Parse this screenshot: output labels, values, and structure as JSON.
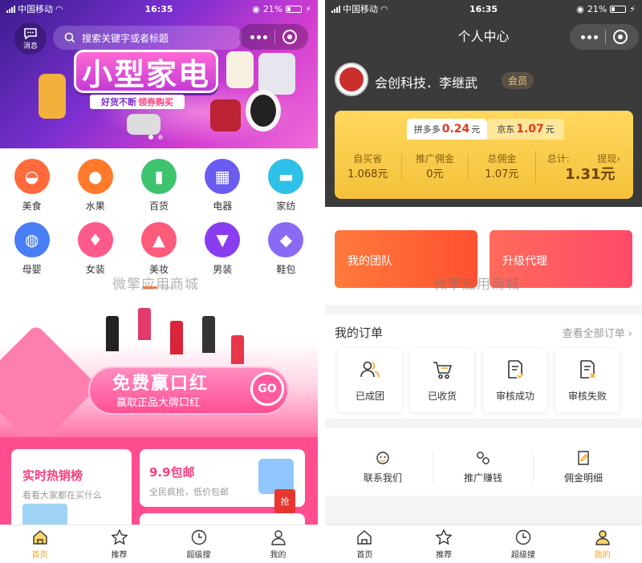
{
  "status_left": {
    "carrier": "中国移动",
    "time": "16:35",
    "battery": "21%"
  },
  "status_right": {
    "carrier": "中国移动",
    "time": "16:35",
    "battery": "21%"
  },
  "left": {
    "msg_label": "消息",
    "search_placeholder": "搜索关键字或者标题",
    "banner_title": "小型家电",
    "banner_sub1": "好货不断",
    "banner_sub2": "领券购买",
    "categories": [
      {
        "label": "美食",
        "color": "#ff6a3c"
      },
      {
        "label": "水果",
        "color": "#ff7a2a"
      },
      {
        "label": "百货",
        "color": "#3ec46d"
      },
      {
        "label": "电器",
        "color": "#6a5cf0"
      },
      {
        "label": "家纺",
        "color": "#2ec0e6"
      },
      {
        "label": "母婴",
        "color": "#4a7ef5"
      },
      {
        "label": "女装",
        "color": "#ff5b8a"
      },
      {
        "label": "美妆",
        "color": "#ff5b7a"
      },
      {
        "label": "男装",
        "color": "#8a3cf0"
      },
      {
        "label": "鞋包",
        "color": "#8a6af5"
      }
    ],
    "watermark": "微擎应用商城",
    "promo_title": "免费赢口红",
    "promo_sub": "赢取正品大牌口红",
    "promo_go": "GO",
    "card1": {
      "title": "实时热销榜",
      "sub": "看看大家都在买什么"
    },
    "card2": {
      "title": "9.9包邮",
      "sub": "全民疯抢，低价包邮",
      "tag": "抢"
    },
    "tabs": [
      "首页",
      "推荐",
      "超级搜",
      "我的"
    ]
  },
  "right": {
    "title": "个人中心",
    "user_name": "会创科技．李继武",
    "member_badge": "会员",
    "platform_tabs": [
      {
        "name": "拼多多",
        "value": "0.24",
        "unit": "元"
      },
      {
        "name": "京东",
        "value": "1.07",
        "unit": "元"
      }
    ],
    "stats": [
      {
        "label": "自买省",
        "value": "1.068元"
      },
      {
        "label": "推广佣金",
        "value": "0元"
      },
      {
        "label": "总佣金",
        "value": "1.07元"
      }
    ],
    "total_label": "总计:",
    "withdraw_label": "提现›",
    "total_value": "1.31元",
    "team_label": "我的团队",
    "upgrade_label": "升级代理",
    "watermark": "微擎应用商城",
    "orders_title": "我的订单",
    "all_orders": "查看全部订单 ›",
    "orders": [
      "已成团",
      "已收货",
      "审核成功",
      "审核失败"
    ],
    "tools": [
      "联系我们",
      "推广赚钱",
      "佣金明细"
    ],
    "tabs": [
      "首页",
      "推荐",
      "超级搜",
      "我的"
    ]
  }
}
